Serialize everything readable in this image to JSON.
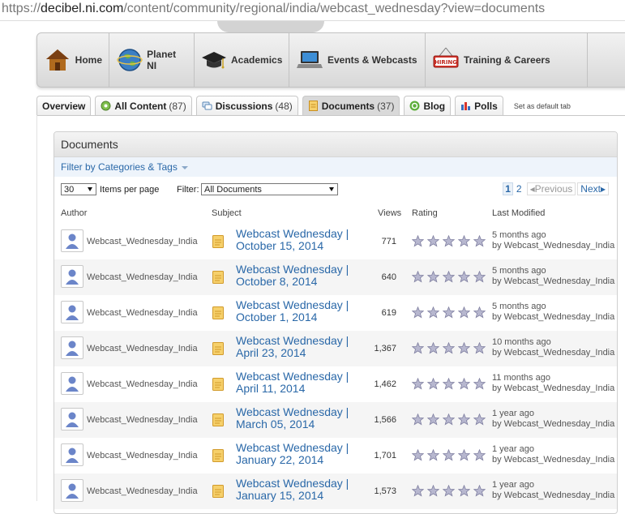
{
  "url": {
    "prefix": "https://",
    "domain": "decibel.ni.com",
    "path": "/content/community/regional/india/webcast_wednesday?view=documents"
  },
  "nav": {
    "items": [
      {
        "label": "Home",
        "icon": "house-icon"
      },
      {
        "label": "Planet NI",
        "icon": "globe-icon"
      },
      {
        "label": "Academics",
        "icon": "graduation-cap-icon"
      },
      {
        "label": "Events & Webcasts",
        "icon": "laptop-icon"
      },
      {
        "label": "Training & Careers",
        "icon": "hiring-sign-icon"
      }
    ]
  },
  "tabs": [
    {
      "label": "Overview",
      "count": "",
      "icon": ""
    },
    {
      "label": "All Content",
      "count": "(87)",
      "icon": "all-content-icon"
    },
    {
      "label": "Discussions",
      "count": "(48)",
      "icon": "discussions-icon"
    },
    {
      "label": "Documents",
      "count": "(37)",
      "icon": "document-icon",
      "active": true
    },
    {
      "label": "Blog",
      "count": "",
      "icon": "blog-icon"
    },
    {
      "label": "Polls",
      "count": "",
      "icon": "polls-icon"
    }
  ],
  "set_default": "Set as default tab",
  "panel": {
    "title": "Documents",
    "filter_link": "Filter by Categories & Tags",
    "items_per_page_value": "30",
    "items_per_page_label": "Items per page",
    "filter_label": "Filter:",
    "filter_value": "All Documents",
    "pager": {
      "current": "1",
      "page2": "2",
      "prev": "Previous",
      "next": "Next"
    }
  },
  "columns": {
    "author": "Author",
    "subject": "Subject",
    "views": "Views",
    "rating": "Rating",
    "modified": "Last Modified"
  },
  "rows": [
    {
      "author": "Webcast_Wednesday_India",
      "subject_l1": "Webcast Wednesday |",
      "subject_l2": "October 15, 2014",
      "views": "771",
      "mod_l1": "5 months ago",
      "mod_l2": "by Webcast_Wednesday_India"
    },
    {
      "author": "Webcast_Wednesday_India",
      "subject_l1": "Webcast Wednesday |",
      "subject_l2": "October 8, 2014",
      "views": "640",
      "mod_l1": "5 months ago",
      "mod_l2": "by Webcast_Wednesday_India"
    },
    {
      "author": "Webcast_Wednesday_India",
      "subject_l1": "Webcast Wednesday |",
      "subject_l2": "October 1, 2014",
      "views": "619",
      "mod_l1": "5 months ago",
      "mod_l2": "by Webcast_Wednesday_India"
    },
    {
      "author": "Webcast_Wednesday_India",
      "subject_l1": "Webcast Wednesday |",
      "subject_l2": "April 23, 2014",
      "views": "1,367",
      "mod_l1": "10 months ago",
      "mod_l2": "by Webcast_Wednesday_India"
    },
    {
      "author": "Webcast_Wednesday_India",
      "subject_l1": "Webcast Wednesday |",
      "subject_l2": "April 11, 2014",
      "views": "1,462",
      "mod_l1": "11 months ago",
      "mod_l2": "by Webcast_Wednesday_India"
    },
    {
      "author": "Webcast_Wednesday_India",
      "subject_l1": "Webcast Wednesday |",
      "subject_l2": "March 05, 2014",
      "views": "1,566",
      "mod_l1": "1 year ago",
      "mod_l2": "by Webcast_Wednesday_India"
    },
    {
      "author": "Webcast_Wednesday_India",
      "subject_l1": "Webcast Wednesday |",
      "subject_l2": "January 22, 2014",
      "views": "1,701",
      "mod_l1": "1 year ago",
      "mod_l2": "by Webcast_Wednesday_India"
    },
    {
      "author": "Webcast_Wednesday_India",
      "subject_l1": "Webcast Wednesday |",
      "subject_l2": "January 15, 2014",
      "views": "1,573",
      "mod_l1": "1 year ago",
      "mod_l2": "by Webcast_Wednesday_India"
    }
  ],
  "colors": {
    "link": "#2a68a8",
    "star": "#9a9ab8"
  }
}
